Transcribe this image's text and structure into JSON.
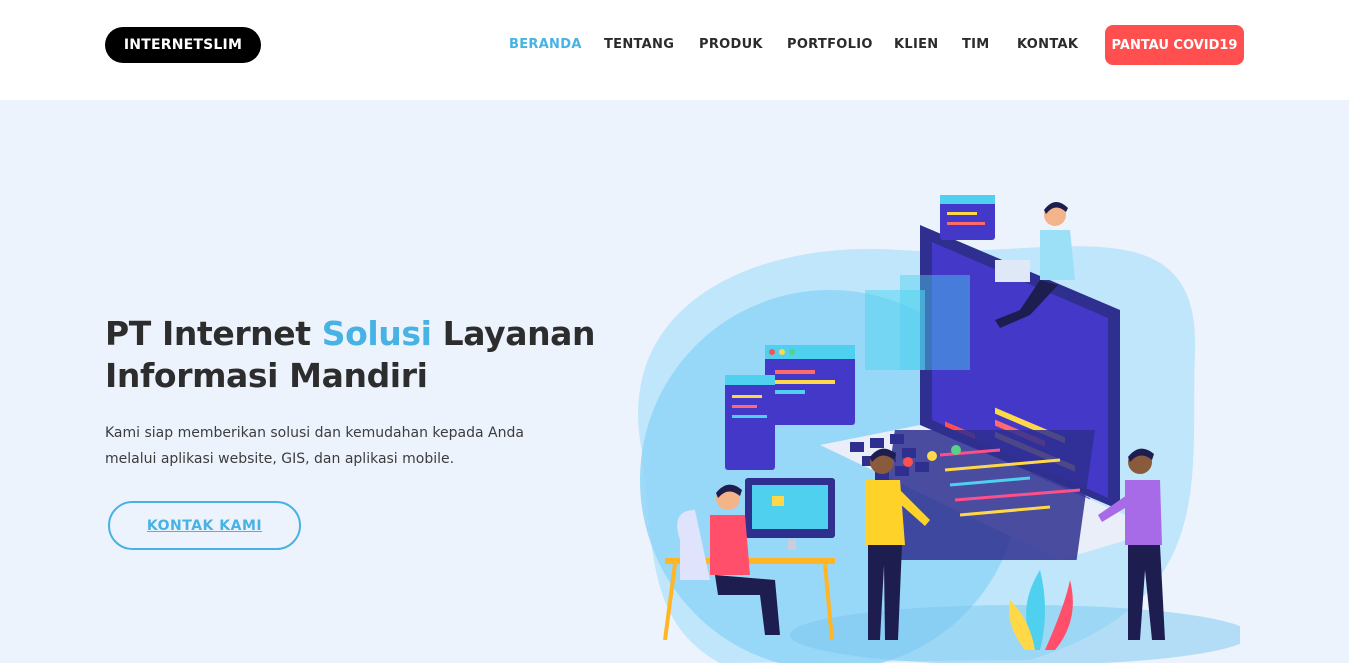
{
  "nav": {
    "logo": "INTERNETSLIM",
    "items": [
      "BERANDA",
      "TENTANG",
      "PRODUK",
      "PORTFOLIO",
      "KLIEN",
      "TIM",
      "KONTAK"
    ],
    "active": "BERANDA",
    "cta": "PANTAU COVID19"
  },
  "hero": {
    "title_part1": "PT Internet ",
    "title_highlight": "Solusi",
    "title_part2": " Layanan Informasi Mandiri",
    "description": "Kami siap memberikan solusi dan kemudahan kepada Anda melalui aplikasi website, GIS, dan aplikasi mobile.",
    "button": "KONTAK KAMI"
  },
  "colors": {
    "accent": "#47b2e4",
    "cta": "#ff4f4f",
    "hero_bg": "#edf3fd",
    "text": "#2d2d2d"
  }
}
